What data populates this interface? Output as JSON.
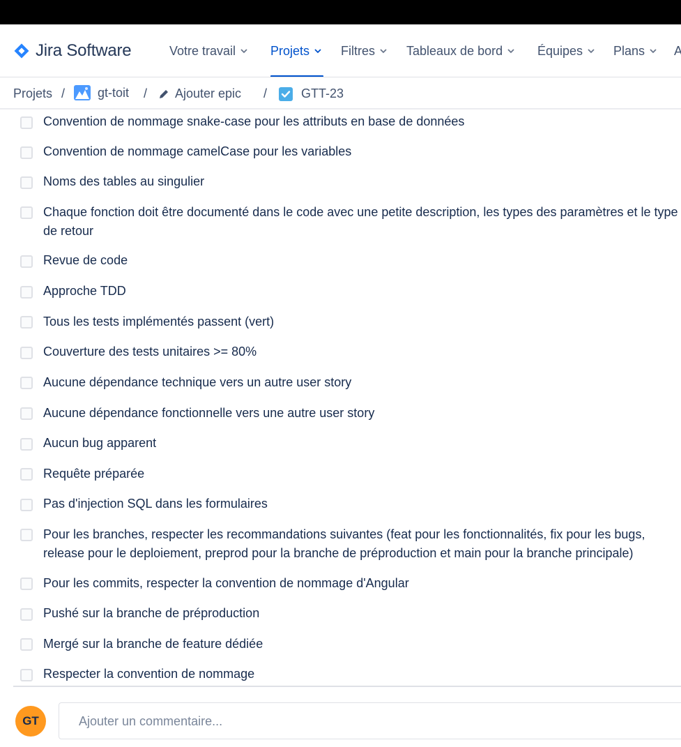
{
  "app": {
    "logo_text": "Jira Software",
    "accent_color": "#0052cc"
  },
  "nav": {
    "items": [
      {
        "label": "Votre travail",
        "active": false
      },
      {
        "label": "Projets",
        "active": true
      },
      {
        "label": "Filtres",
        "active": false
      },
      {
        "label": "Tableaux de bord",
        "active": false
      },
      {
        "label": "Équipes",
        "active": false
      },
      {
        "label": "Plans",
        "active": false
      },
      {
        "label": "A",
        "active": false
      }
    ]
  },
  "breadcrumb": {
    "projects": "Projets",
    "project": "gt-toit",
    "project_icon": "project-avatar-icon",
    "epic": "Ajouter epic",
    "epic_icon": "pencil-icon",
    "issue": "GTT-23",
    "issue_icon": "task-checkbox-icon",
    "separator": "/"
  },
  "checklist": {
    "items": [
      {
        "label": "Convention de nommage snake-case pour les attributs en base de données",
        "checked": false
      },
      {
        "label": "Convention de nommage camelCase pour les variables",
        "checked": false
      },
      {
        "label": "Noms des tables au singulier",
        "checked": false
      },
      {
        "label": "Chaque fonction doit être documenté dans le code avec une petite description, les types des paramètres et le type de retour",
        "checked": false
      },
      {
        "label": "Revue de code",
        "checked": false
      },
      {
        "label": "Approche TDD",
        "checked": false
      },
      {
        "label": "Tous les tests implémentés passent (vert)",
        "checked": false
      },
      {
        "label": "Couverture des tests unitaires >= 80%",
        "checked": false
      },
      {
        "label": "Aucune dépendance technique vers un autre user story",
        "checked": false
      },
      {
        "label": "Aucune dépendance fonctionnelle vers une autre user story",
        "checked": false
      },
      {
        "label": "Aucun bug apparent",
        "checked": false
      },
      {
        "label": "Requête préparée",
        "checked": false
      },
      {
        "label": "Pas d'injection SQL dans les formulaires",
        "checked": false
      },
      {
        "label": "Pour les branches, respecter les recommandations suivantes (feat pour les fonctionnalités, fix pour les bugs, release pour le deploiement, preprod pour la branche de préproduction et main pour la branche principale)",
        "checked": false
      },
      {
        "label": "Pour les commits, respecter la convention de nommage d'Angular",
        "checked": false
      },
      {
        "label": "Pushé sur la branche de préproduction",
        "checked": false
      },
      {
        "label": "Mergé sur la branche de feature dédiée",
        "checked": false
      },
      {
        "label": "Respecter la convention de nommage",
        "checked": false
      }
    ]
  },
  "comment": {
    "avatar_initials": "GT",
    "avatar_color": "#ff991f",
    "placeholder": "Ajouter un commentaire..."
  }
}
